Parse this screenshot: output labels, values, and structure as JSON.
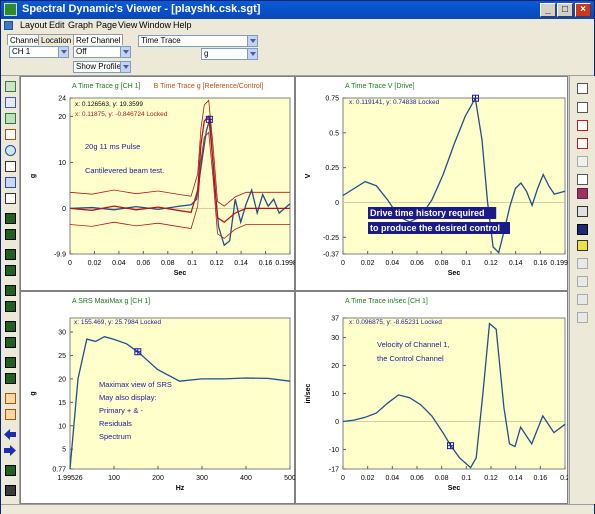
{
  "titlebar": {
    "title": "Spectral Dynamic's Viewer - [playshk.csk.sgt]",
    "buttons": [
      "_",
      "□",
      "×"
    ]
  },
  "menu": [
    "Layout",
    "Edit",
    "Graph",
    "Page",
    "View",
    "Window",
    "Help"
  ],
  "toolbar": {
    "tabs": [
      "Channel",
      "Location",
      "Ref Channel"
    ],
    "channel_value": "CH 1",
    "ref_channel_value": "Off",
    "show_profile": "Show Profile",
    "trace_type": "Time Trace",
    "unit": "g"
  },
  "colors": {
    "plot_bg": "#ffffcc",
    "trace_blue": "#1f4f8f",
    "trace_red": "#b01818",
    "text_blue": "#1a1aa0",
    "green_title": "#1c7a1c",
    "orange_title": "#c05010"
  },
  "panels": [
    {
      "id": "p1",
      "titles": [
        {
          "text": "A Time Trace g [CH 1]",
          "color": "#1c7a1c"
        },
        {
          "text": "B Time Trace g [Reference/Control]",
          "color": "#c05010"
        }
      ],
      "cursors": [
        {
          "text": "x: 0.126563, y: 19.3599",
          "color": "#000000"
        },
        {
          "text": "x: 0.11875, y: -0.846724 Locked",
          "color": "#b01818"
        }
      ],
      "annotations": [
        "20g 11 ms Pulse",
        "Cantilevered beam test."
      ],
      "ylabel": "g",
      "xlabel": "Sec",
      "yticks": [
        "24",
        "20",
        "10",
        "0",
        "-9.9"
      ],
      "xticks": [
        "0",
        "0.02",
        "0.04",
        "0.06",
        "0.08",
        "0.1",
        "0.12",
        "0.14",
        "0.16",
        "0.199805"
      ]
    },
    {
      "id": "p2",
      "titles": [
        {
          "text": "A Time Trace V [Drive]",
          "color": "#1c7a1c"
        }
      ],
      "cursors": [
        {
          "text": "x: 0.119141, y: 0.74838 Locked",
          "color": "#1a1aa0"
        }
      ],
      "annotations": [
        "Drive time history required",
        "to produce the desired control"
      ],
      "ylabel": "V",
      "xlabel": "Sec",
      "yticks": [
        "0.75",
        "0.5",
        "0.25",
        "0",
        "-0.25",
        "-0.37"
      ],
      "xticks": [
        "0",
        "0.02",
        "0.04",
        "0.06",
        "0.08",
        "0.1",
        "0.12",
        "0.14",
        "0.16",
        "0.199609"
      ]
    },
    {
      "id": "p3",
      "titles": [
        {
          "text": "A SRS MaxiMax g [CH 1]",
          "color": "#1c7a1c"
        }
      ],
      "cursors": [
        {
          "text": "x: 155.469, y: 25.7984 Locked",
          "color": "#1a1aa0"
        }
      ],
      "annotations": [
        "Maximax view of SRS",
        "May also display:",
        "Primary + & -",
        "Residuals",
        "Spectrum"
      ],
      "ylabel": "g",
      "xlabel": "Hz",
      "yticks": [
        "30",
        "25",
        "20",
        "15",
        "10",
        "5",
        "0.77"
      ],
      "xticks": [
        "1.99526",
        "100",
        "200",
        "300",
        "400",
        "500"
      ]
    },
    {
      "id": "p4",
      "titles": [
        {
          "text": "A Time Trace in/sec [CH 1]",
          "color": "#1c7a1c"
        }
      ],
      "cursors": [
        {
          "text": "x: 0.096875, y: -8.65231 Locked",
          "color": "#1a1aa0"
        }
      ],
      "annotations": [
        "Velocity of Channel 1,",
        "the Control Channel"
      ],
      "ylabel": "in/sec",
      "xlabel": "Sec",
      "yticks": [
        "37",
        "30",
        "20",
        "10",
        "0",
        "-10",
        "-17"
      ],
      "xticks": [
        "0",
        "0.02",
        "0.04",
        "0.06",
        "0.08",
        "0.1",
        "0.12",
        "0.14",
        "0.16",
        "0.2"
      ]
    }
  ],
  "chart_data": [
    {
      "type": "line",
      "title": "A Time Trace g [CH 1]",
      "xlabel": "Sec",
      "ylabel": "g",
      "xlim": [
        0,
        0.199805
      ],
      "ylim": [
        -9.9,
        24
      ],
      "series": [
        {
          "name": "A Time Trace g [CH 1]",
          "x": [
            0,
            0.02,
            0.04,
            0.06,
            0.08,
            0.1,
            0.11,
            0.115,
            0.119,
            0.124,
            0.127,
            0.131,
            0.135,
            0.14,
            0.145,
            0.15,
            0.155,
            0.16,
            0.165,
            0.17,
            0.175,
            0.18,
            0.185,
            0.19,
            0.1998
          ],
          "y": [
            0,
            0.2,
            -0.3,
            0.4,
            -0.2,
            0.5,
            0.8,
            2,
            9,
            17,
            19.4,
            6,
            -4,
            -8,
            -7,
            2,
            -3,
            1,
            4,
            -1,
            3,
            0.5,
            2,
            -1,
            1
          ]
        },
        {
          "name": "B Time Trace g [Reference/Control]",
          "x": [
            0,
            0.02,
            0.04,
            0.06,
            0.08,
            0.1,
            0.11,
            0.116,
            0.119,
            0.122,
            0.126,
            0.13,
            0.134,
            0.14,
            0.15,
            0.16,
            0.17,
            0.18,
            0.19,
            0.1998
          ],
          "y": [
            0,
            -0.4,
            0.5,
            -0.3,
            0.3,
            -0.5,
            -0.85,
            4,
            14,
            19,
            20,
            10,
            -2,
            -3,
            -1,
            0,
            0,
            0,
            0,
            0
          ]
        }
      ]
    },
    {
      "type": "line",
      "title": "A Time Trace V [Drive]",
      "xlabel": "Sec",
      "ylabel": "V",
      "xlim": [
        0,
        0.199609
      ],
      "ylim": [
        -0.37,
        0.75
      ],
      "series": [
        {
          "name": "A Time Trace V [Drive]",
          "x": [
            0,
            0.01,
            0.02,
            0.03,
            0.04,
            0.05,
            0.06,
            0.07,
            0.08,
            0.09,
            0.1,
            0.11,
            0.119,
            0.125,
            0.13,
            0.135,
            0.14,
            0.145,
            0.15,
            0.155,
            0.16,
            0.165,
            0.17,
            0.175,
            0.18,
            0.185,
            0.19,
            0.1996
          ],
          "y": [
            0.05,
            0.1,
            0.15,
            0.12,
            0.02,
            -0.1,
            -0.14,
            -0.1,
            0.02,
            0.2,
            0.42,
            0.62,
            0.748,
            0.45,
            0.0,
            -0.32,
            -0.36,
            -0.2,
            -0.03,
            0.1,
            0.14,
            0.08,
            -0.02,
            0.1,
            0.2,
            0.12,
            0.06,
            0.08
          ]
        }
      ]
    },
    {
      "type": "line",
      "title": "A SRS MaxiMax g [CH 1]",
      "xlabel": "Hz",
      "ylabel": "g",
      "xlim": [
        1.99526,
        500
      ],
      "ylim": [
        0.77,
        33
      ],
      "series": [
        {
          "name": "A SRS MaxiMax g [CH 1]",
          "x": [
            1.99526,
            20,
            40,
            60,
            80,
            100,
            130,
            155.469,
            200,
            250,
            300,
            350,
            400,
            450,
            500
          ],
          "y": [
            0.77,
            20,
            28.5,
            28,
            29,
            28.5,
            27.5,
            25.8,
            22,
            19.5,
            20,
            20,
            20.2,
            20.1,
            19.5
          ]
        }
      ]
    },
    {
      "type": "line",
      "title": "A Time Trace in/sec [CH 1]",
      "xlabel": "Sec",
      "ylabel": "in/sec",
      "xlim": [
        0,
        0.2
      ],
      "ylim": [
        -17,
        37
      ],
      "series": [
        {
          "name": "A Time Trace in/sec [CH 1]",
          "x": [
            0,
            0.01,
            0.02,
            0.03,
            0.04,
            0.05,
            0.06,
            0.07,
            0.08,
            0.09,
            0.097,
            0.105,
            0.115,
            0.12,
            0.126,
            0.132,
            0.138,
            0.145,
            0.15,
            0.155,
            0.16,
            0.17,
            0.18,
            0.19,
            0.2
          ],
          "y": [
            0,
            0.5,
            1.5,
            3,
            6.5,
            9.5,
            8.5,
            6,
            2,
            -4,
            -8.6,
            -13,
            -16.5,
            -13,
            10,
            35,
            33,
            5,
            -8,
            -9,
            -2,
            -8,
            2,
            -4,
            -1
          ]
        }
      ]
    }
  ]
}
